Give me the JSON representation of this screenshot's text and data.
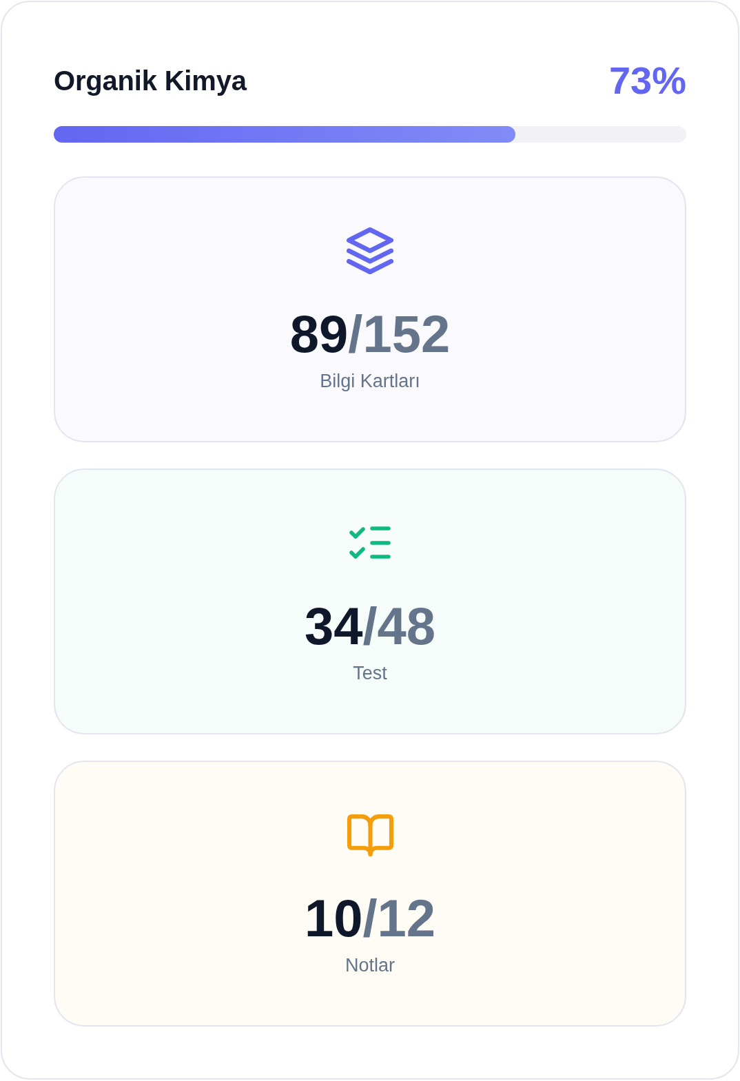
{
  "header": {
    "title": "Organik Kimya",
    "percent": "73%"
  },
  "progress": {
    "level": 0.73
  },
  "cards": [
    {
      "kind": "layers",
      "color": "#6366f1",
      "done": "89",
      "total": "/152",
      "label": "Bilgi Kartları"
    },
    {
      "kind": "checklist",
      "color": "#10b981",
      "done": "34",
      "total": "/48",
      "label": "Test"
    },
    {
      "kind": "book",
      "color": "#f59e0b",
      "done": "10",
      "total": "/12",
      "label": "Notlar"
    }
  ]
}
